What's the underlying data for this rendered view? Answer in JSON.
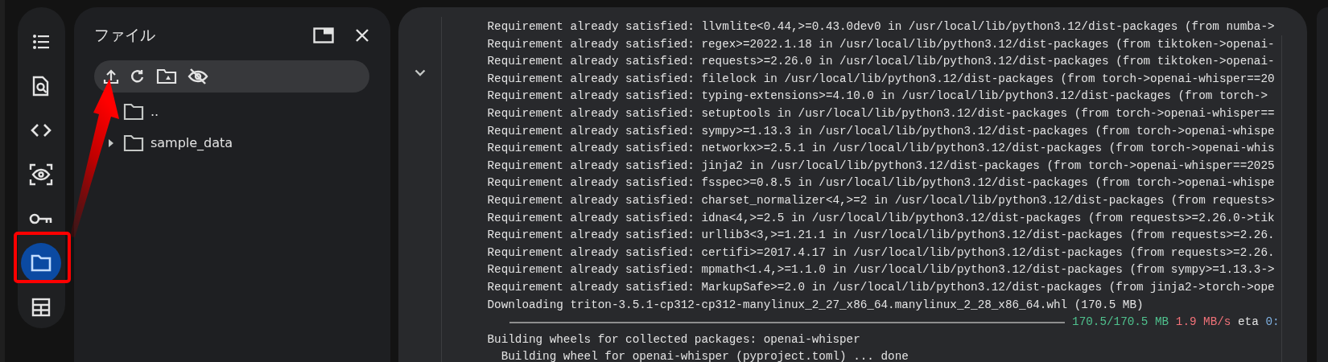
{
  "rail": [
    {
      "kind": "toc",
      "selected": false
    },
    {
      "kind": "find",
      "selected": false
    },
    {
      "kind": "code",
      "selected": false
    },
    {
      "kind": "variables",
      "selected": false
    },
    {
      "kind": "secrets",
      "selected": false
    },
    {
      "kind": "files",
      "selected": true
    },
    {
      "kind": "table",
      "selected": false
    }
  ],
  "files_panel": {
    "title": "ファイル",
    "entries": [
      {
        "name": ".."
      },
      {
        "name": "sample_data",
        "expanded": false
      }
    ]
  },
  "cell": {
    "collapsed": false,
    "output": [
      {
        "kind": "text",
        "text": "Requirement already satisfied: llvmlite<0.44,>=0.43.0dev0 in /usr/local/lib/python3.12/dist-packages (from numba->"
      },
      {
        "kind": "text",
        "text": "Requirement already satisfied: regex>=2022.1.18 in /usr/local/lib/python3.12/dist-packages (from tiktoken->openai-"
      },
      {
        "kind": "text",
        "text": "Requirement already satisfied: requests>=2.26.0 in /usr/local/lib/python3.12/dist-packages (from tiktoken->openai-"
      },
      {
        "kind": "text",
        "text": "Requirement already satisfied: filelock in /usr/local/lib/python3.12/dist-packages (from torch->openai-whisper==20"
      },
      {
        "kind": "text",
        "text": "Requirement already satisfied: typing-extensions>=4.10.0 in /usr/local/lib/python3.12/dist-packages (from torch->"
      },
      {
        "kind": "text",
        "text": "Requirement already satisfied: setuptools in /usr/local/lib/python3.12/dist-packages (from torch->openai-whisper=="
      },
      {
        "kind": "text",
        "text": "Requirement already satisfied: sympy>=1.13.3 in /usr/local/lib/python3.12/dist-packages (from torch->openai-whispe"
      },
      {
        "kind": "text",
        "text": "Requirement already satisfied: networkx>=2.5.1 in /usr/local/lib/python3.12/dist-packages (from torch->openai-whis"
      },
      {
        "kind": "text",
        "text": "Requirement already satisfied: jinja2 in /usr/local/lib/python3.12/dist-packages (from torch->openai-whisper==2025"
      },
      {
        "kind": "text",
        "text": "Requirement already satisfied: fsspec>=0.8.5 in /usr/local/lib/python3.12/dist-packages (from torch->openai-whispe"
      },
      {
        "kind": "text",
        "text": "Requirement already satisfied: charset_normalizer<4,>=2 in /usr/local/lib/python3.12/dist-packages (from requests>"
      },
      {
        "kind": "text",
        "text": "Requirement already satisfied: idna<4,>=2.5 in /usr/local/lib/python3.12/dist-packages (from requests>=2.26.0->tik"
      },
      {
        "kind": "text",
        "text": "Requirement already satisfied: urllib3<3,>=1.21.1 in /usr/local/lib/python3.12/dist-packages (from requests>=2.26."
      },
      {
        "kind": "text",
        "text": "Requirement already satisfied: certifi>=2017.4.17 in /usr/local/lib/python3.12/dist-packages (from requests>=2.26."
      },
      {
        "kind": "text",
        "text": "Requirement already satisfied: mpmath<1.4,>=1.1.0 in /usr/local/lib/python3.12/dist-packages (from sympy>=1.13.3->"
      },
      {
        "kind": "text",
        "text": "Requirement already satisfied: MarkupSafe>=2.0 in /usr/local/lib/python3.12/dist-packages (from jinja2->torch->ope"
      },
      {
        "kind": "text",
        "text": "Downloading triton-3.5.1-cp312-cp312-manylinux_2_27_x86_64.manylinux_2_28_x86_64.whl (170.5 MB)"
      },
      {
        "kind": "progress",
        "level": 1,
        "size": "170.5/170.5 MB",
        "speed": "1.9 MB/s",
        "eta_label": "eta",
        "eta": "0:"
      },
      {
        "kind": "text",
        "text": "Building wheels for collected packages: openai-whisper"
      },
      {
        "kind": "text",
        "text": "  Building wheel for openai-whisper (pyproject.toml) ... done"
      }
    ]
  }
}
